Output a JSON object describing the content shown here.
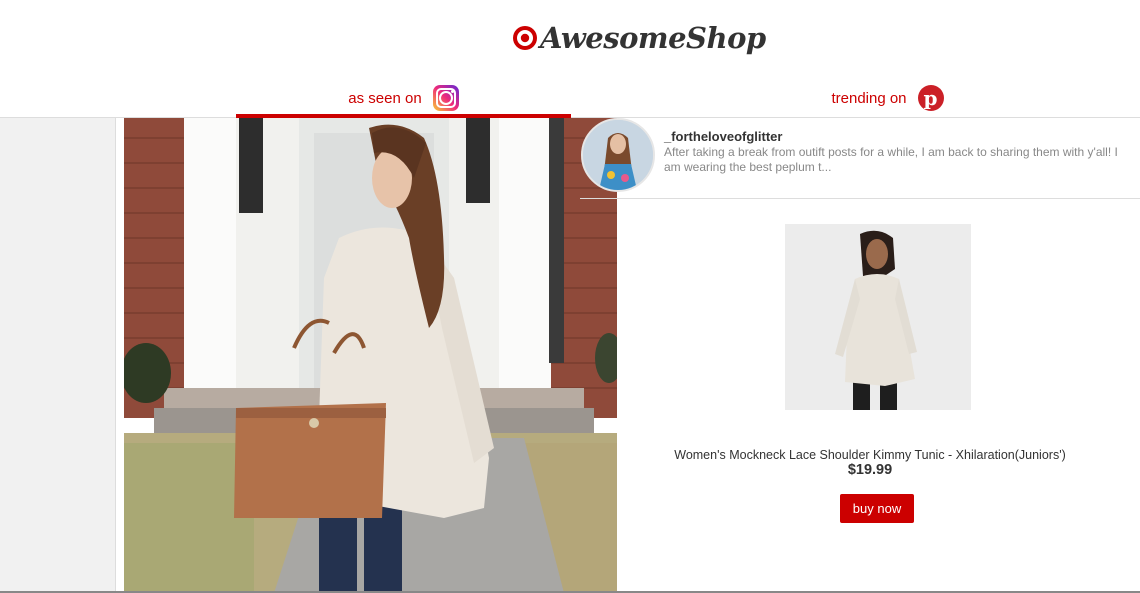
{
  "brand": {
    "name": "AwesomeShop",
    "logo_icon": "target-bullseye-icon",
    "accent": "#cc0000"
  },
  "tabs": [
    {
      "label": "as seen on",
      "icon": "instagram-icon",
      "active": true
    },
    {
      "label": "trending on",
      "icon": "pinterest-icon",
      "active": false
    }
  ],
  "post": {
    "username": "_fortheloveofglitter",
    "caption": "After taking a break from outift posts for a while, I am back to sharing them with y'all! I am wearing the best peplum t..."
  },
  "product": {
    "title": "Women's Mockneck Lace Shoulder Kimmy Tunic - Xhilaration(Juniors')",
    "price": "$19.99",
    "buy_label": "buy now"
  }
}
